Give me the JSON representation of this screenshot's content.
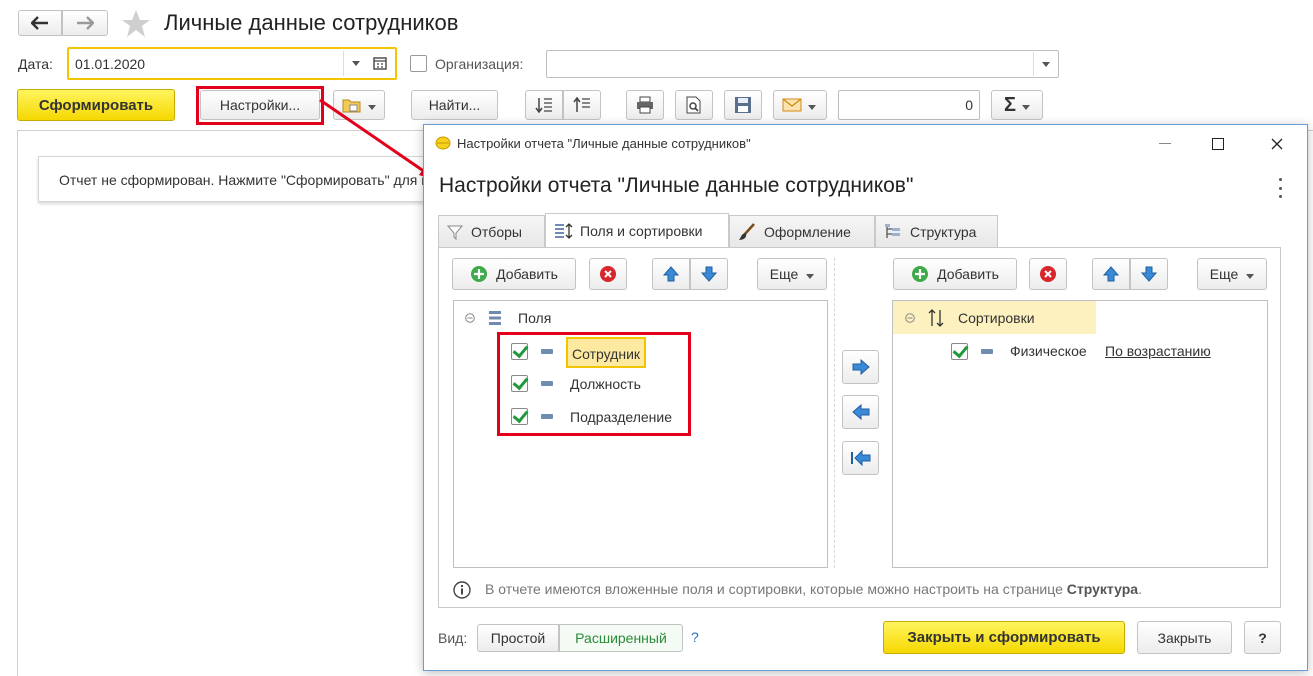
{
  "window": {
    "title": "Личные данные сотрудников"
  },
  "filters": {
    "date_label": "Дата:",
    "date_value": "01.01.2020",
    "org_label": "Организация:",
    "org_value": ""
  },
  "toolbar": {
    "generate_label": "Сформировать",
    "settings_label": "Настройки...",
    "find_label": "Найти...",
    "sum_value": "0",
    "sum_symbol": "Σ"
  },
  "report": {
    "placeholder": "Отчет не сформирован. Нажмите \"Сформировать\" для получения отчета."
  },
  "dialog": {
    "window_title": "Настройки отчета \"Личные данные сотрудников\"",
    "heading": "Настройки отчета \"Личные данные сотрудников\"",
    "tabs": [
      {
        "label": "Отборы",
        "icon": "funnel-icon"
      },
      {
        "label": "Поля и сортировки",
        "icon": "fields-sort-icon"
      },
      {
        "label": "Оформление",
        "icon": "brush-icon"
      },
      {
        "label": "Структура",
        "icon": "structure-icon"
      }
    ],
    "left_panel": {
      "add_label": "Добавить",
      "more_label": "Еще",
      "root_label": "Поля",
      "fields": [
        {
          "label": "Сотрудник",
          "checked": true
        },
        {
          "label": "Должность",
          "checked": true
        },
        {
          "label": "Подразделение",
          "checked": true
        }
      ]
    },
    "right_panel": {
      "add_label": "Добавить",
      "more_label": "Еще",
      "root_label": "Сортировки",
      "items": [
        {
          "label": "Физическое",
          "order": "По возрастанию",
          "checked": true
        }
      ]
    },
    "info_text": "В отчете имеются вложенные поля и сортировки, которые можно настроить на странице",
    "info_link": "Структура",
    "info_end": ".",
    "view_label": "Вид:",
    "view_simple": "Простой",
    "view_extended": "Расширенный",
    "help_mark": "?",
    "close_generate_label": "Закрыть и сформировать",
    "close_label": "Закрыть",
    "help_button": "?"
  },
  "colors": {
    "accent_yellow": "#f5d800",
    "highlight_red": "#e3001b",
    "check_green": "#1f9a3b"
  }
}
